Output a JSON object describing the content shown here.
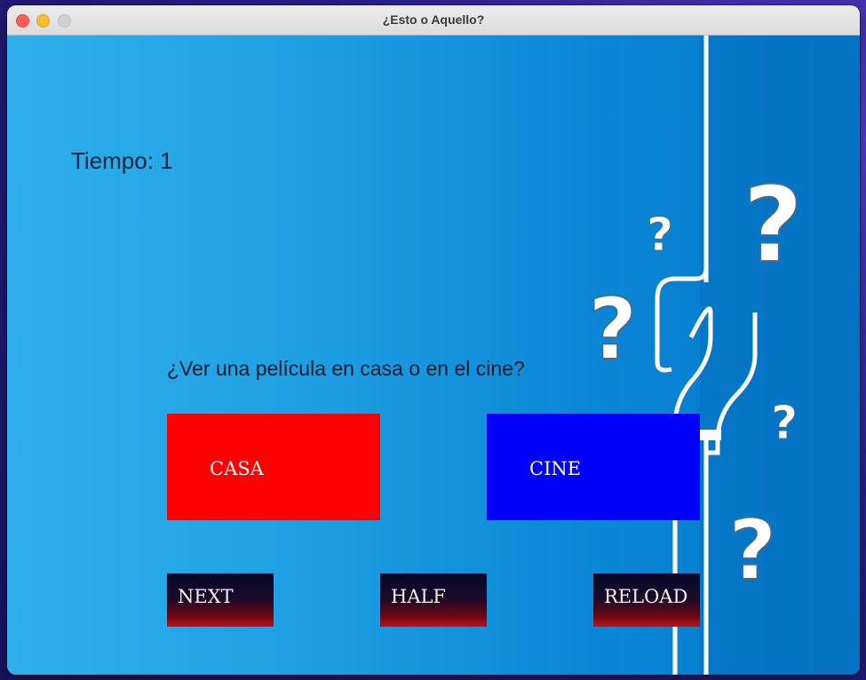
{
  "window": {
    "title": "¿Esto o Aquello?"
  },
  "game": {
    "timer_text": "Tiempo: 1",
    "question": "¿Ver una película en casa o en el cine?",
    "option_a": {
      "label": "CASA",
      "color": "#ff0000"
    },
    "option_b": {
      "label": "CINE",
      "color": "#0000ff"
    }
  },
  "controls": {
    "next": "NEXT",
    "half": "HALF",
    "reload": "RELOAD"
  },
  "background": {
    "decoration": "question-marks",
    "colors": [
      "#2fb0ec",
      "#0577c8"
    ]
  }
}
